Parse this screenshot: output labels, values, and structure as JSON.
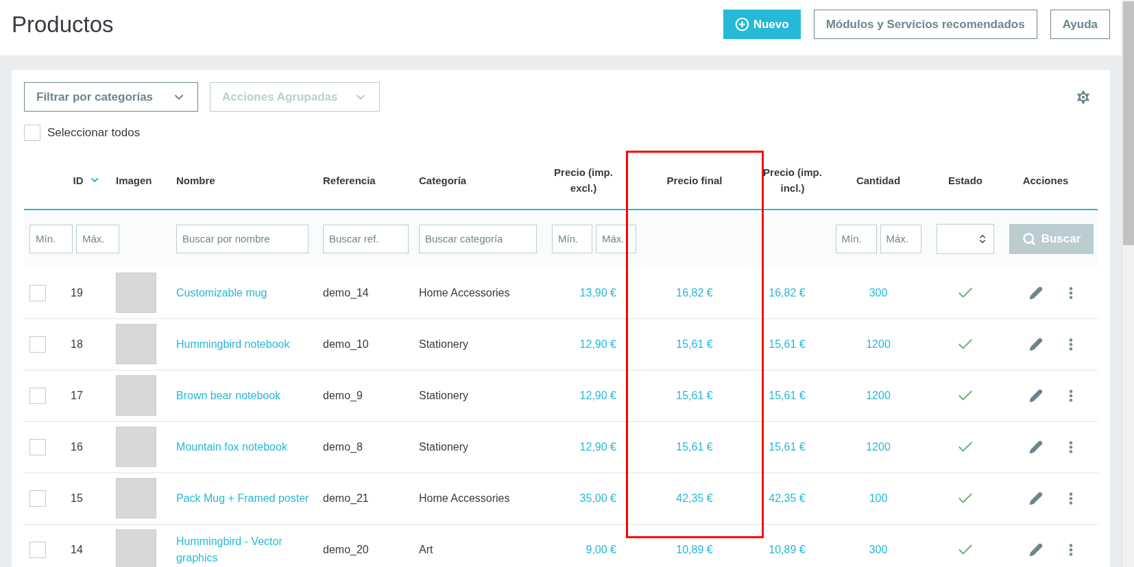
{
  "header": {
    "title": "Productos",
    "buttons": [
      {
        "kind": "primary",
        "label": "Nuevo"
      },
      {
        "kind": "outline",
        "label": "Módulos y Servicios recomendados"
      },
      {
        "kind": "outline",
        "label": "Ayuda"
      }
    ]
  },
  "toolbar": {
    "category_filter": {
      "label": "Filtrar por categorías",
      "disabled": false
    },
    "bulk_actions": {
      "label": "Acciones Agrupadas",
      "disabled": true
    },
    "select_all": {
      "label": "Seleccionar todos",
      "checked": false
    }
  },
  "table": {
    "columns": [
      {
        "label": "ID",
        "sorted": true
      },
      {
        "label": "Imagen",
        "sorted": false
      },
      {
        "label": "Nombre",
        "sorted": false
      },
      {
        "label": "Referencia",
        "sorted": false
      },
      {
        "label": "Categoría",
        "sorted": false
      },
      {
        "label": "Precio (imp. excl.)",
        "sorted": false
      },
      {
        "label": "Precio final",
        "sorted": false
      },
      {
        "label": "Precio (imp. incl.)",
        "sorted": false
      },
      {
        "label": "Cantidad",
        "sorted": false
      },
      {
        "label": "Estado",
        "sorted": false
      },
      {
        "label": "Acciones",
        "sorted": false
      }
    ],
    "filters": {
      "id": [
        {
          "placeholder": "Mín."
        },
        {
          "placeholder": "Máx."
        }
      ],
      "name": {
        "placeholder": "Buscar por nombre"
      },
      "reference": {
        "placeholder": "Buscar ref."
      },
      "category": {
        "placeholder": "Buscar categoría"
      },
      "price": [
        {
          "placeholder": "Mín."
        },
        {
          "placeholder": "Máx."
        }
      ],
      "quantity": [
        {
          "placeholder": "Mín."
        },
        {
          "placeholder": "Máx."
        }
      ],
      "search_button": "Buscar"
    },
    "rows": [
      {
        "selected": false,
        "id": "19",
        "name": "Customizable mug",
        "reference": "demo_14",
        "category": "Home Accessories",
        "price_excl": "13,90 €",
        "price_final": "16,82 €",
        "price_incl": "16,82 €",
        "quantity": "300",
        "enabled": true
      },
      {
        "selected": false,
        "id": "18",
        "name": "Hummingbird notebook",
        "reference": "demo_10",
        "category": "Stationery",
        "price_excl": "12,90 €",
        "price_final": "15,61 €",
        "price_incl": "15,61 €",
        "quantity": "1200",
        "enabled": true
      },
      {
        "selected": false,
        "id": "17",
        "name": "Brown bear notebook",
        "reference": "demo_9",
        "category": "Stationery",
        "price_excl": "12,90 €",
        "price_final": "15,61 €",
        "price_incl": "15,61 €",
        "quantity": "1200",
        "enabled": true
      },
      {
        "selected": false,
        "id": "16",
        "name": "Mountain fox notebook",
        "reference": "demo_8",
        "category": "Stationery",
        "price_excl": "12,90 €",
        "price_final": "15,61 €",
        "price_incl": "15,61 €",
        "quantity": "1200",
        "enabled": true
      },
      {
        "selected": false,
        "id": "15",
        "name": "Pack Mug + Framed poster",
        "reference": "demo_21",
        "category": "Home Accessories",
        "price_excl": "35,00 €",
        "price_final": "42,35 €",
        "price_incl": "42,35 €",
        "quantity": "100",
        "enabled": true
      },
      {
        "selected": false,
        "id": "14",
        "name": "Hummingbird - Vector graphics",
        "reference": "demo_20",
        "category": "Art",
        "price_excl": "9,00 €",
        "price_final": "10,89 €",
        "price_incl": "10,89 €",
        "quantity": "300",
        "enabled": true
      }
    ]
  }
}
